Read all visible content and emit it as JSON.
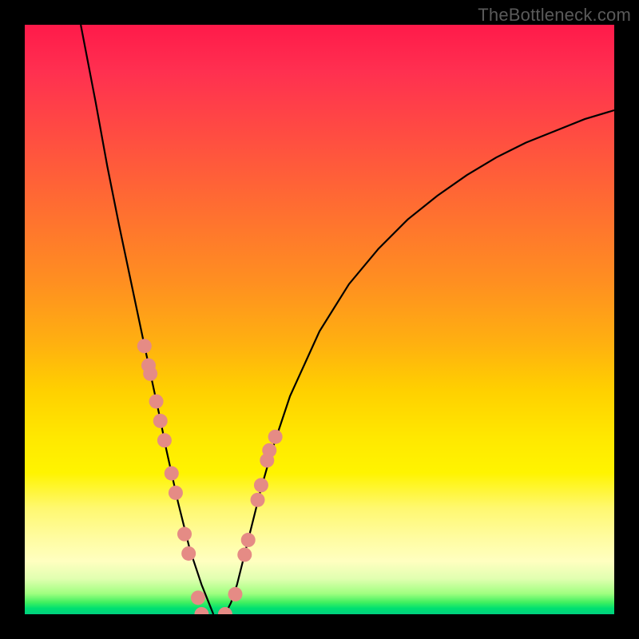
{
  "watermark": "TheBottleneck.com",
  "chart_data": {
    "type": "line",
    "title": "",
    "xlabel": "",
    "ylabel": "",
    "xlim": [
      0,
      100
    ],
    "ylim": [
      0,
      100
    ],
    "grid": false,
    "curve_left": {
      "x": [
        9.5,
        12,
        14,
        16,
        18,
        20,
        21.5,
        23,
        24,
        25,
        26,
        27,
        28,
        29,
        30,
        31,
        32
      ],
      "y": [
        100,
        87,
        76,
        66,
        56.5,
        47,
        40,
        33,
        28,
        23.5,
        19,
        15,
        11,
        8,
        5,
        2.5,
        0
      ]
    },
    "curve_right": {
      "x": [
        34,
        35,
        36,
        37,
        38,
        40,
        42,
        45,
        50,
        55,
        60,
        65,
        70,
        75,
        80,
        85,
        90,
        95,
        100
      ],
      "y": [
        0,
        2,
        5,
        9,
        13,
        21,
        28,
        37,
        48,
        56,
        62,
        67,
        71,
        74.5,
        77.5,
        80,
        82,
        84,
        85.5
      ]
    },
    "markers_left": {
      "x": [
        20.3,
        21.0,
        21.3,
        22.3,
        23.0,
        23.7,
        24.9,
        25.6,
        27.1,
        27.8,
        29.4,
        30.0
      ],
      "y": [
        45.5,
        42.2,
        40.8,
        36.1,
        32.8,
        29.5,
        23.9,
        20.6,
        13.6,
        10.3,
        2.8,
        0.0
      ]
    },
    "markers_right": {
      "x": [
        34.0,
        35.7,
        37.3,
        37.9,
        39.5,
        40.1,
        41.1,
        41.5,
        42.5
      ],
      "y": [
        0.0,
        3.4,
        10.1,
        12.6,
        19.4,
        21.9,
        26.1,
        27.8,
        30.1
      ]
    }
  }
}
